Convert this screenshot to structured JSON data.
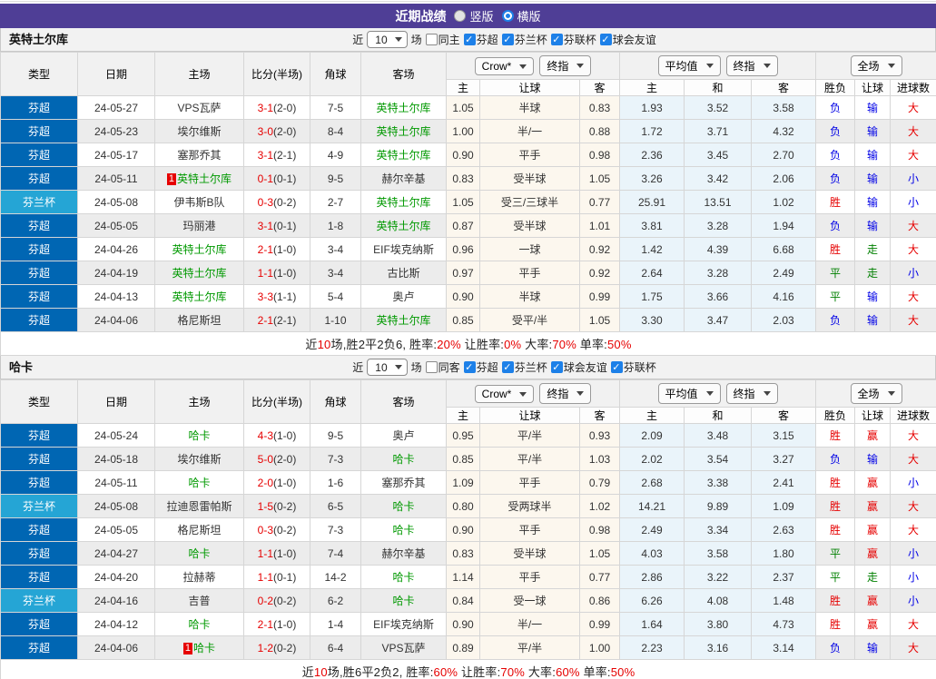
{
  "title_bar": {
    "title": "近期战绩",
    "radios": [
      {
        "label": "竖版",
        "selected": false
      },
      {
        "label": "横版",
        "selected": true
      }
    ]
  },
  "colors": {
    "header_purple": "#4f3e96",
    "league_super_blue": "#0066b3",
    "league_cup_blue": "#25a5d5",
    "checkbox_blue": "#1d80e8",
    "self_team_green": "#009900",
    "win_red": "#e60000",
    "lose_blue": "#0000e6",
    "draw_green": "#008000",
    "handicap_bg": "#fcf7ee",
    "average_bg": "#eaf4fa"
  },
  "table_header": {
    "cols": [
      "类型",
      "日期",
      "主场",
      "比分(半场)",
      "角球",
      "客场"
    ],
    "group1": {
      "dd1": "Crow*",
      "dd2": "终指"
    },
    "group2": {
      "dd1": "平均值",
      "dd2": "终指"
    },
    "group3": {
      "dd": "全场"
    },
    "sub": [
      "主",
      "让球",
      "客",
      "主",
      "和",
      "客",
      "胜负",
      "让球",
      "进球数"
    ]
  },
  "sections": [
    {
      "team": "英特土尔库",
      "filter": {
        "near_label": "近",
        "count": "10",
        "unit_label": "场",
        "same": {
          "label": "同主",
          "checked": false
        },
        "leagues": [
          {
            "label": "芬超",
            "checked": true
          },
          {
            "label": "芬兰杯",
            "checked": true
          },
          {
            "label": "芬联杯",
            "checked": true
          },
          {
            "label": "球会友谊",
            "checked": true
          }
        ]
      },
      "rows": [
        {
          "league": "芬超",
          "cup": false,
          "date": "24-05-27",
          "home": {
            "name": "VPS瓦萨"
          },
          "ft": "3-1",
          "ht": "(2-0)",
          "corners": "7-5",
          "away": {
            "name": "英特土尔库",
            "self": true
          },
          "hc": [
            "1.05",
            "半球",
            "0.83"
          ],
          "avg": [
            "1.93",
            "3.52",
            "3.58"
          ],
          "res": [
            [
              "负",
              "blue"
            ],
            [
              "输",
              "blue"
            ],
            [
              "大",
              "red"
            ]
          ]
        },
        {
          "league": "芬超",
          "cup": false,
          "date": "24-05-23",
          "home": {
            "name": "埃尔维斯"
          },
          "ft": "3-0",
          "ht": "(2-0)",
          "corners": "8-4",
          "away": {
            "name": "英特土尔库",
            "self": true
          },
          "hc": [
            "1.00",
            "半/一",
            "0.88"
          ],
          "avg": [
            "1.72",
            "3.71",
            "4.32"
          ],
          "res": [
            [
              "负",
              "blue"
            ],
            [
              "输",
              "blue"
            ],
            [
              "大",
              "red"
            ]
          ]
        },
        {
          "league": "芬超",
          "cup": false,
          "date": "24-05-17",
          "home": {
            "name": "塞那乔其"
          },
          "ft": "3-1",
          "ht": "(2-1)",
          "corners": "4-9",
          "away": {
            "name": "英特土尔库",
            "self": true
          },
          "hc": [
            "0.90",
            "平手",
            "0.98"
          ],
          "avg": [
            "2.36",
            "3.45",
            "2.70"
          ],
          "res": [
            [
              "负",
              "blue"
            ],
            [
              "输",
              "blue"
            ],
            [
              "大",
              "red"
            ]
          ]
        },
        {
          "league": "芬超",
          "cup": false,
          "date": "24-05-11",
          "home": {
            "name": "英特土尔库",
            "self": true,
            "rank": "1"
          },
          "ft": "0-1",
          "ht": "(0-1)",
          "corners": "9-5",
          "away": {
            "name": "赫尔辛基"
          },
          "hc": [
            "0.83",
            "受半球",
            "1.05"
          ],
          "avg": [
            "3.26",
            "3.42",
            "2.06"
          ],
          "res": [
            [
              "负",
              "blue"
            ],
            [
              "输",
              "blue"
            ],
            [
              "小",
              "blue"
            ]
          ]
        },
        {
          "league": "芬兰杯",
          "cup": true,
          "date": "24-05-08",
          "home": {
            "name": "伊韦斯B队"
          },
          "ft": "0-3",
          "ht": "(0-2)",
          "corners": "2-7",
          "away": {
            "name": "英特土尔库",
            "self": true
          },
          "hc": [
            "1.05",
            "受三/三球半",
            "0.77"
          ],
          "avg": [
            "25.91",
            "13.51",
            "1.02"
          ],
          "res": [
            [
              "胜",
              "red"
            ],
            [
              "输",
              "blue"
            ],
            [
              "小",
              "blue"
            ]
          ]
        },
        {
          "league": "芬超",
          "cup": false,
          "date": "24-05-05",
          "home": {
            "name": "玛丽港"
          },
          "ft": "3-1",
          "ht": "(0-1)",
          "corners": "1-8",
          "away": {
            "name": "英特土尔库",
            "self": true
          },
          "hc": [
            "0.87",
            "受半球",
            "1.01"
          ],
          "avg": [
            "3.81",
            "3.28",
            "1.94"
          ],
          "res": [
            [
              "负",
              "blue"
            ],
            [
              "输",
              "blue"
            ],
            [
              "大",
              "red"
            ]
          ]
        },
        {
          "league": "芬超",
          "cup": false,
          "date": "24-04-26",
          "home": {
            "name": "英特土尔库",
            "self": true
          },
          "ft": "2-1",
          "ht": "(1-0)",
          "corners": "3-4",
          "away": {
            "name": "EIF埃克纳斯"
          },
          "hc": [
            "0.96",
            "一球",
            "0.92"
          ],
          "avg": [
            "1.42",
            "4.39",
            "6.68"
          ],
          "res": [
            [
              "胜",
              "red"
            ],
            [
              "走",
              "green"
            ],
            [
              "大",
              "red"
            ]
          ]
        },
        {
          "league": "芬超",
          "cup": false,
          "date": "24-04-19",
          "home": {
            "name": "英特土尔库",
            "self": true
          },
          "ft": "1-1",
          "ht": "(1-0)",
          "corners": "3-4",
          "away": {
            "name": "古比斯"
          },
          "hc": [
            "0.97",
            "平手",
            "0.92"
          ],
          "avg": [
            "2.64",
            "3.28",
            "2.49"
          ],
          "res": [
            [
              "平",
              "green"
            ],
            [
              "走",
              "green"
            ],
            [
              "小",
              "blue"
            ]
          ]
        },
        {
          "league": "芬超",
          "cup": false,
          "date": "24-04-13",
          "home": {
            "name": "英特土尔库",
            "self": true
          },
          "ft": "3-3",
          "ht": "(1-1)",
          "corners": "5-4",
          "away": {
            "name": "奥卢"
          },
          "hc": [
            "0.90",
            "半球",
            "0.99"
          ],
          "avg": [
            "1.75",
            "3.66",
            "4.16"
          ],
          "res": [
            [
              "平",
              "green"
            ],
            [
              "输",
              "blue"
            ],
            [
              "大",
              "red"
            ]
          ]
        },
        {
          "league": "芬超",
          "cup": false,
          "date": "24-04-06",
          "home": {
            "name": "格尼斯坦"
          },
          "ft": "2-1",
          "ht": "(2-1)",
          "corners": "1-10",
          "away": {
            "name": "英特土尔库",
            "self": true
          },
          "hc": [
            "0.85",
            "受平/半",
            "1.05"
          ],
          "avg": [
            "3.30",
            "3.47",
            "2.03"
          ],
          "res": [
            [
              "负",
              "blue"
            ],
            [
              "输",
              "blue"
            ],
            [
              "大",
              "red"
            ]
          ]
        }
      ],
      "summary": [
        {
          "t": "近",
          "red": false
        },
        {
          "t": "10",
          "red": true
        },
        {
          "t": "场,胜2平2负6, 胜率:",
          "red": false
        },
        {
          "t": "20%",
          "red": true
        },
        {
          "t": " 让胜率:",
          "red": false
        },
        {
          "t": "0%",
          "red": true
        },
        {
          "t": " 大率:",
          "red": false
        },
        {
          "t": "70%",
          "red": true
        },
        {
          "t": " 单率:",
          "red": false
        },
        {
          "t": "50%",
          "red": true
        }
      ]
    },
    {
      "team": "哈卡",
      "filter": {
        "near_label": "近",
        "count": "10",
        "unit_label": "场",
        "same": {
          "label": "同客",
          "checked": false
        },
        "leagues": [
          {
            "label": "芬超",
            "checked": true
          },
          {
            "label": "芬兰杯",
            "checked": true
          },
          {
            "label": "球会友谊",
            "checked": true
          },
          {
            "label": "芬联杯",
            "checked": true
          }
        ]
      },
      "rows": [
        {
          "league": "芬超",
          "cup": false,
          "date": "24-05-24",
          "home": {
            "name": "哈卡",
            "self": true
          },
          "ft": "4-3",
          "ht": "(1-0)",
          "corners": "9-5",
          "away": {
            "name": "奥卢"
          },
          "hc": [
            "0.95",
            "平/半",
            "0.93"
          ],
          "avg": [
            "2.09",
            "3.48",
            "3.15"
          ],
          "res": [
            [
              "胜",
              "red"
            ],
            [
              "赢",
              "red"
            ],
            [
              "大",
              "red"
            ]
          ]
        },
        {
          "league": "芬超",
          "cup": false,
          "date": "24-05-18",
          "home": {
            "name": "埃尔维斯"
          },
          "ft": "5-0",
          "ht": "(2-0)",
          "corners": "7-3",
          "away": {
            "name": "哈卡",
            "self": true
          },
          "hc": [
            "0.85",
            "平/半",
            "1.03"
          ],
          "avg": [
            "2.02",
            "3.54",
            "3.27"
          ],
          "res": [
            [
              "负",
              "blue"
            ],
            [
              "输",
              "blue"
            ],
            [
              "大",
              "red"
            ]
          ]
        },
        {
          "league": "芬超",
          "cup": false,
          "date": "24-05-11",
          "home": {
            "name": "哈卡",
            "self": true
          },
          "ft": "2-0",
          "ht": "(1-0)",
          "corners": "1-6",
          "away": {
            "name": "塞那乔其"
          },
          "hc": [
            "1.09",
            "平手",
            "0.79"
          ],
          "avg": [
            "2.68",
            "3.38",
            "2.41"
          ],
          "res": [
            [
              "胜",
              "red"
            ],
            [
              "赢",
              "red"
            ],
            [
              "小",
              "blue"
            ]
          ]
        },
        {
          "league": "芬兰杯",
          "cup": true,
          "date": "24-05-08",
          "home": {
            "name": "拉迪恩雷帕斯"
          },
          "ft": "1-5",
          "ht": "(0-2)",
          "corners": "6-5",
          "away": {
            "name": "哈卡",
            "self": true
          },
          "hc": [
            "0.80",
            "受两球半",
            "1.02"
          ],
          "avg": [
            "14.21",
            "9.89",
            "1.09"
          ],
          "res": [
            [
              "胜",
              "red"
            ],
            [
              "赢",
              "red"
            ],
            [
              "大",
              "red"
            ]
          ]
        },
        {
          "league": "芬超",
          "cup": false,
          "date": "24-05-05",
          "home": {
            "name": "格尼斯坦"
          },
          "ft": "0-3",
          "ht": "(0-2)",
          "corners": "7-3",
          "away": {
            "name": "哈卡",
            "self": true
          },
          "hc": [
            "0.90",
            "平手",
            "0.98"
          ],
          "avg": [
            "2.49",
            "3.34",
            "2.63"
          ],
          "res": [
            [
              "胜",
              "red"
            ],
            [
              "赢",
              "red"
            ],
            [
              "大",
              "red"
            ]
          ]
        },
        {
          "league": "芬超",
          "cup": false,
          "date": "24-04-27",
          "home": {
            "name": "哈卡",
            "self": true
          },
          "ft": "1-1",
          "ht": "(1-0)",
          "corners": "7-4",
          "away": {
            "name": "赫尔辛基"
          },
          "hc": [
            "0.83",
            "受半球",
            "1.05"
          ],
          "avg": [
            "4.03",
            "3.58",
            "1.80"
          ],
          "res": [
            [
              "平",
              "green"
            ],
            [
              "赢",
              "red"
            ],
            [
              "小",
              "blue"
            ]
          ]
        },
        {
          "league": "芬超",
          "cup": false,
          "date": "24-04-20",
          "home": {
            "name": "拉赫蒂"
          },
          "ft": "1-1",
          "ht": "(0-1)",
          "corners": "14-2",
          "away": {
            "name": "哈卡",
            "self": true
          },
          "hc": [
            "1.14",
            "平手",
            "0.77"
          ],
          "avg": [
            "2.86",
            "3.22",
            "2.37"
          ],
          "res": [
            [
              "平",
              "green"
            ],
            [
              "走",
              "green"
            ],
            [
              "小",
              "blue"
            ]
          ]
        },
        {
          "league": "芬兰杯",
          "cup": true,
          "date": "24-04-16",
          "home": {
            "name": "吉普"
          },
          "ft": "0-2",
          "ht": "(0-2)",
          "corners": "6-2",
          "away": {
            "name": "哈卡",
            "self": true
          },
          "hc": [
            "0.84",
            "受一球",
            "0.86"
          ],
          "avg": [
            "6.26",
            "4.08",
            "1.48"
          ],
          "res": [
            [
              "胜",
              "red"
            ],
            [
              "赢",
              "red"
            ],
            [
              "小",
              "blue"
            ]
          ]
        },
        {
          "league": "芬超",
          "cup": false,
          "date": "24-04-12",
          "home": {
            "name": "哈卡",
            "self": true
          },
          "ft": "2-1",
          "ht": "(1-0)",
          "corners": "1-4",
          "away": {
            "name": "EIF埃克纳斯"
          },
          "hc": [
            "0.90",
            "半/一",
            "0.99"
          ],
          "avg": [
            "1.64",
            "3.80",
            "4.73"
          ],
          "res": [
            [
              "胜",
              "red"
            ],
            [
              "赢",
              "red"
            ],
            [
              "大",
              "red"
            ]
          ]
        },
        {
          "league": "芬超",
          "cup": false,
          "date": "24-04-06",
          "home": {
            "name": "哈卡",
            "self": true,
            "rank": "1"
          },
          "ft": "1-2",
          "ht": "(0-2)",
          "corners": "6-4",
          "away": {
            "name": "VPS瓦萨"
          },
          "hc": [
            "0.89",
            "平/半",
            "1.00"
          ],
          "avg": [
            "2.23",
            "3.16",
            "3.14"
          ],
          "res": [
            [
              "负",
              "blue"
            ],
            [
              "输",
              "blue"
            ],
            [
              "大",
              "red"
            ]
          ]
        }
      ],
      "summary": [
        {
          "t": "近",
          "red": false
        },
        {
          "t": "10",
          "red": true
        },
        {
          "t": "场,胜6平2负2, 胜率:",
          "red": false
        },
        {
          "t": "60%",
          "red": true
        },
        {
          "t": " 让胜率:",
          "red": false
        },
        {
          "t": "70%",
          "red": true
        },
        {
          "t": " 大率:",
          "red": false
        },
        {
          "t": "60%",
          "red": true
        },
        {
          "t": " 单率:",
          "red": false
        },
        {
          "t": "50%",
          "red": true
        }
      ]
    }
  ]
}
